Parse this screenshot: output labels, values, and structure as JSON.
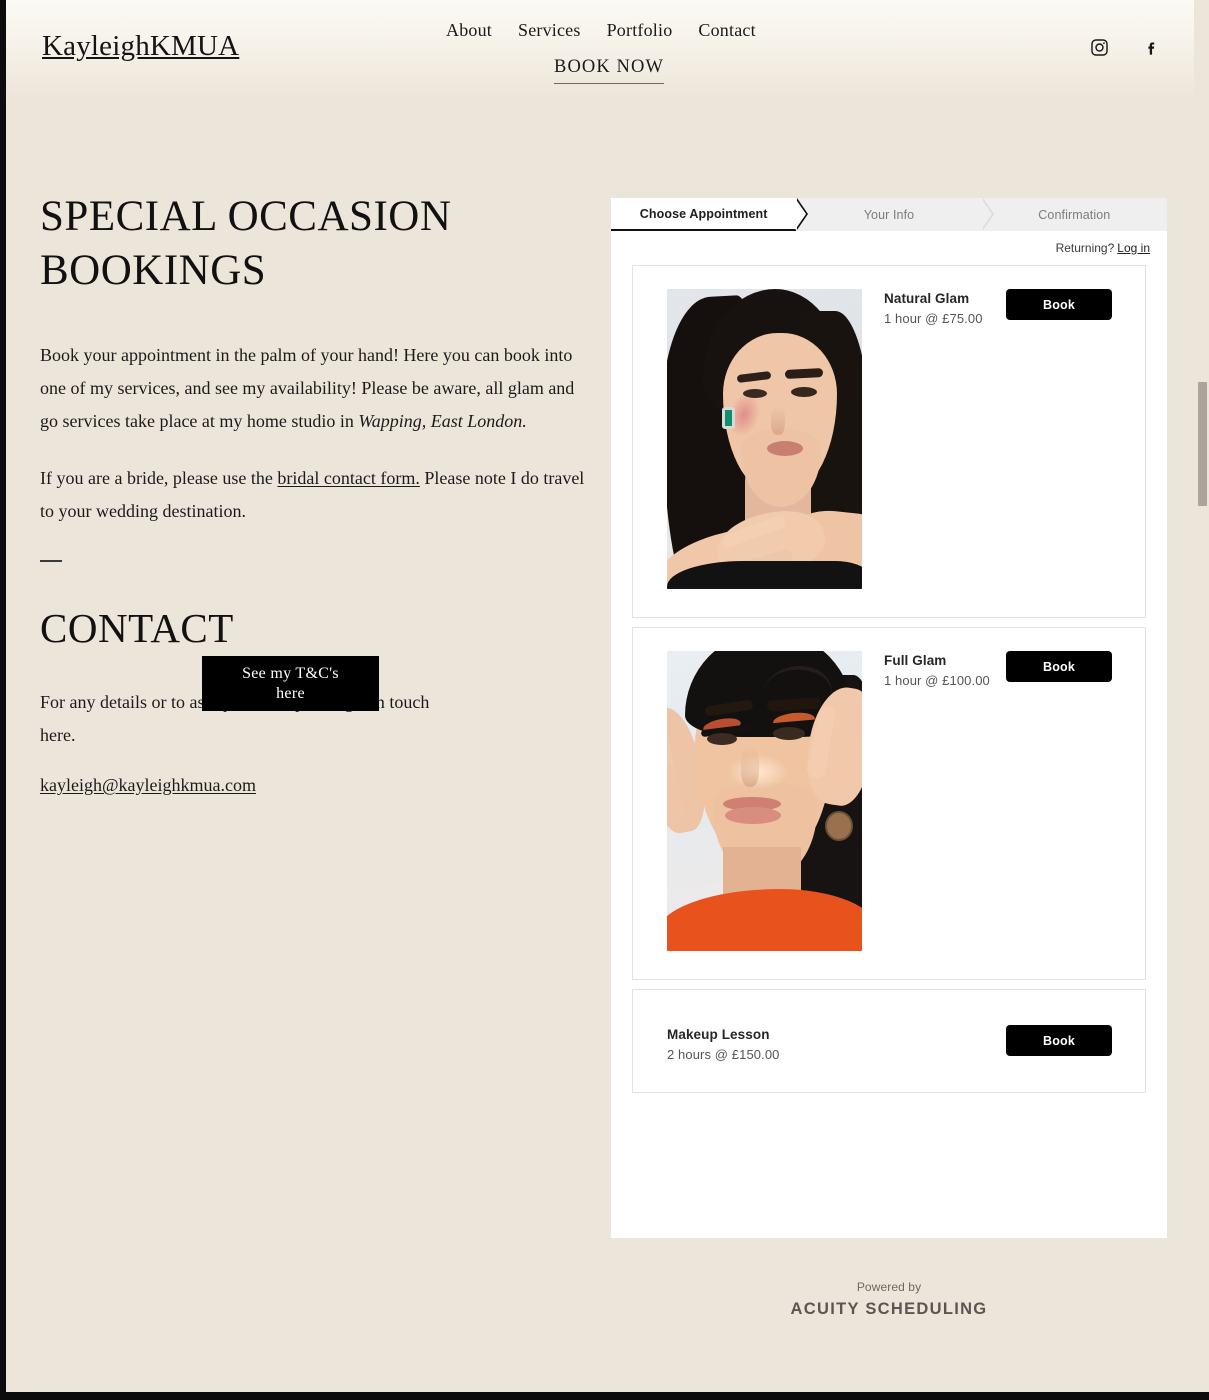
{
  "header": {
    "logo": "KayleighKMUA",
    "nav": [
      {
        "label": "About"
      },
      {
        "label": "Services"
      },
      {
        "label": "Portfolio"
      },
      {
        "label": "Contact"
      }
    ],
    "cta": "BOOK NOW",
    "social": [
      {
        "name": "instagram-icon"
      },
      {
        "name": "facebook-icon"
      }
    ]
  },
  "main": {
    "title": "SPECIAL OCCASION BOOKINGS",
    "intro_part1": "Book your appointment in the palm of your hand! Here you can book into one of my services, and see my availability! Please be aware, all glam and go services take place at my home studio in ",
    "intro_location": "Wapping, East London.",
    "bride_part1": "If you are a bride, please use the ",
    "bride_link": "bridal contact form.",
    "bride_part2": " Please note I do travel to your wedding destination.",
    "contact_title": "CONTACT",
    "contact_text": "For any details or to ask questions, please get in touch here.",
    "email": "kayleigh@kayleighkmua.com",
    "tc_button_line1": "See my T&C's",
    "tc_button_line2": "here"
  },
  "widget": {
    "tabs": [
      {
        "label": "Choose Appointment",
        "active": true
      },
      {
        "label": "Your Info",
        "active": false
      },
      {
        "label": "Confirmation",
        "active": false
      }
    ],
    "returning_text": "Returning?",
    "login_label": "Log in",
    "services": [
      {
        "name": "Natural Glam",
        "duration_price": "1 hour @ £75.00",
        "book_label": "Book",
        "photo": "natural-glam-portrait",
        "has_photo": true
      },
      {
        "name": "Full Glam",
        "duration_price": "1 hour @ £100.00",
        "book_label": "Book",
        "photo": "full-glam-portrait",
        "has_photo": true
      },
      {
        "name": "Makeup Lesson",
        "duration_price": "2 hours @ £150.00",
        "book_label": "Book",
        "photo": null,
        "has_photo": false
      }
    ]
  },
  "footer": {
    "powered_by": "Powered by",
    "brand": "ACUITY SCHEDULING"
  },
  "colors": {
    "page_bg": "#ece5da",
    "accent_black": "#000000",
    "widget_bg": "#ffffff",
    "tab_inactive_bg": "#efefef",
    "footer_text": "#5a5650"
  }
}
